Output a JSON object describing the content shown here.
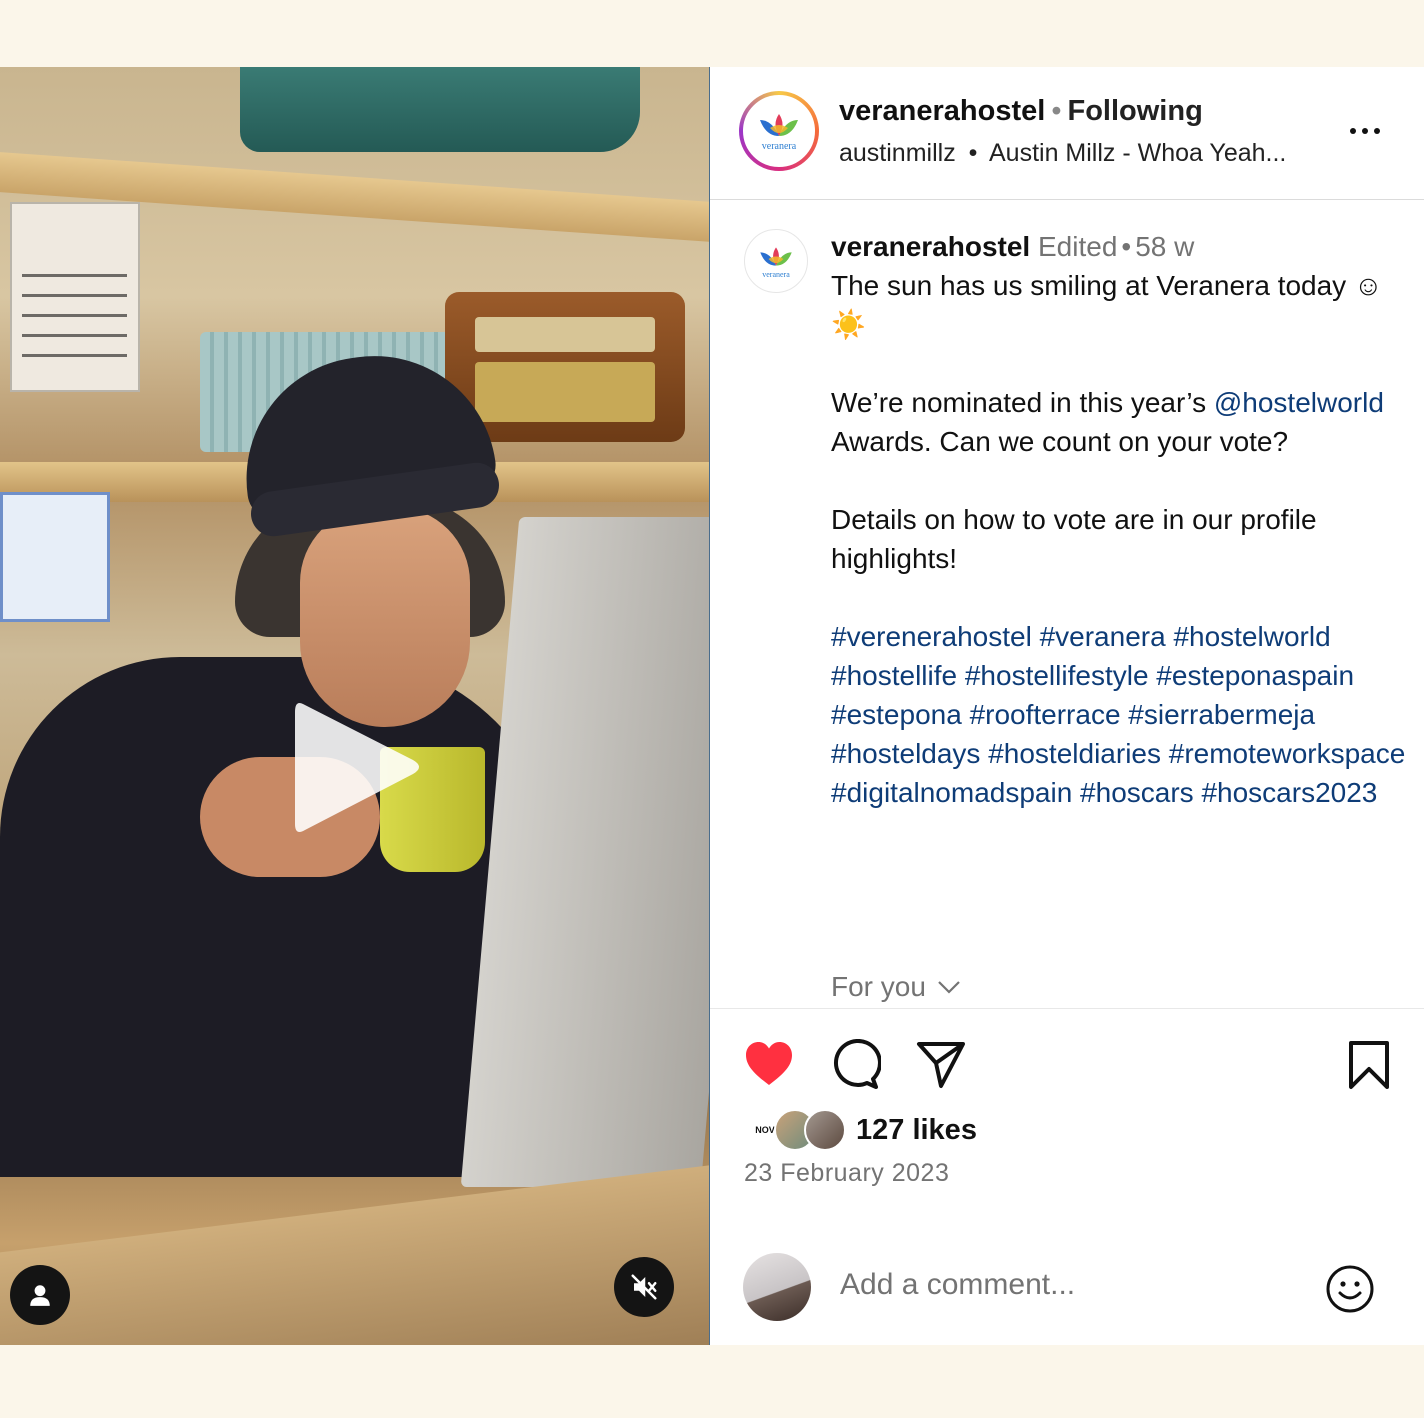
{
  "header": {
    "username": "veranerahostel",
    "separator": "•",
    "follow_status": "Following",
    "audio_artist": "austinmillz",
    "audio_dot": "•",
    "audio_track": "Austin Millz - Whoa Yeah...",
    "logo_text": "veranera"
  },
  "caption": {
    "username": "veranerahostel",
    "edited": "Edited",
    "dot": "•",
    "age": "58 w",
    "line1": "The sun has us smiling at Veranera today ☺☀️",
    "line2_pre": "We’re nominated in this year’s",
    "mention": "@hostelworld",
    "line2_post": "Awards. Can we count on your vote?",
    "line3": "Details on how to vote are in our profile highlights!",
    "hashtags": "#verenerahostel #veranera #hostelworld #hostellife #hostellifestyle #esteponaspain #estepona #roofterrace #sierrabermeja #hosteldays #hosteldiaries #remoteworkspace #digitalnomadspain #hoscars #hoscars2023",
    "for_you": "For you"
  },
  "stats": {
    "likes": "127 likes",
    "date": "23 February 2023",
    "first_liker_badge": "NOV"
  },
  "comment": {
    "placeholder": "Add a comment..."
  },
  "icons": {
    "like": "heart-filled-icon",
    "comment": "comment-bubble-icon",
    "share": "paper-plane-icon",
    "save": "bookmark-icon",
    "more": "more-horizontal-icon",
    "play": "play-icon",
    "mute": "speaker-muted-icon",
    "tagged": "user-icon",
    "emoji": "smiley-icon",
    "chevron": "chevron-down-icon"
  },
  "colors": {
    "like_red": "#ff3040",
    "link_blue": "#0e3c77",
    "muted_gray": "#737373",
    "page_bg": "#fbf6ea"
  }
}
